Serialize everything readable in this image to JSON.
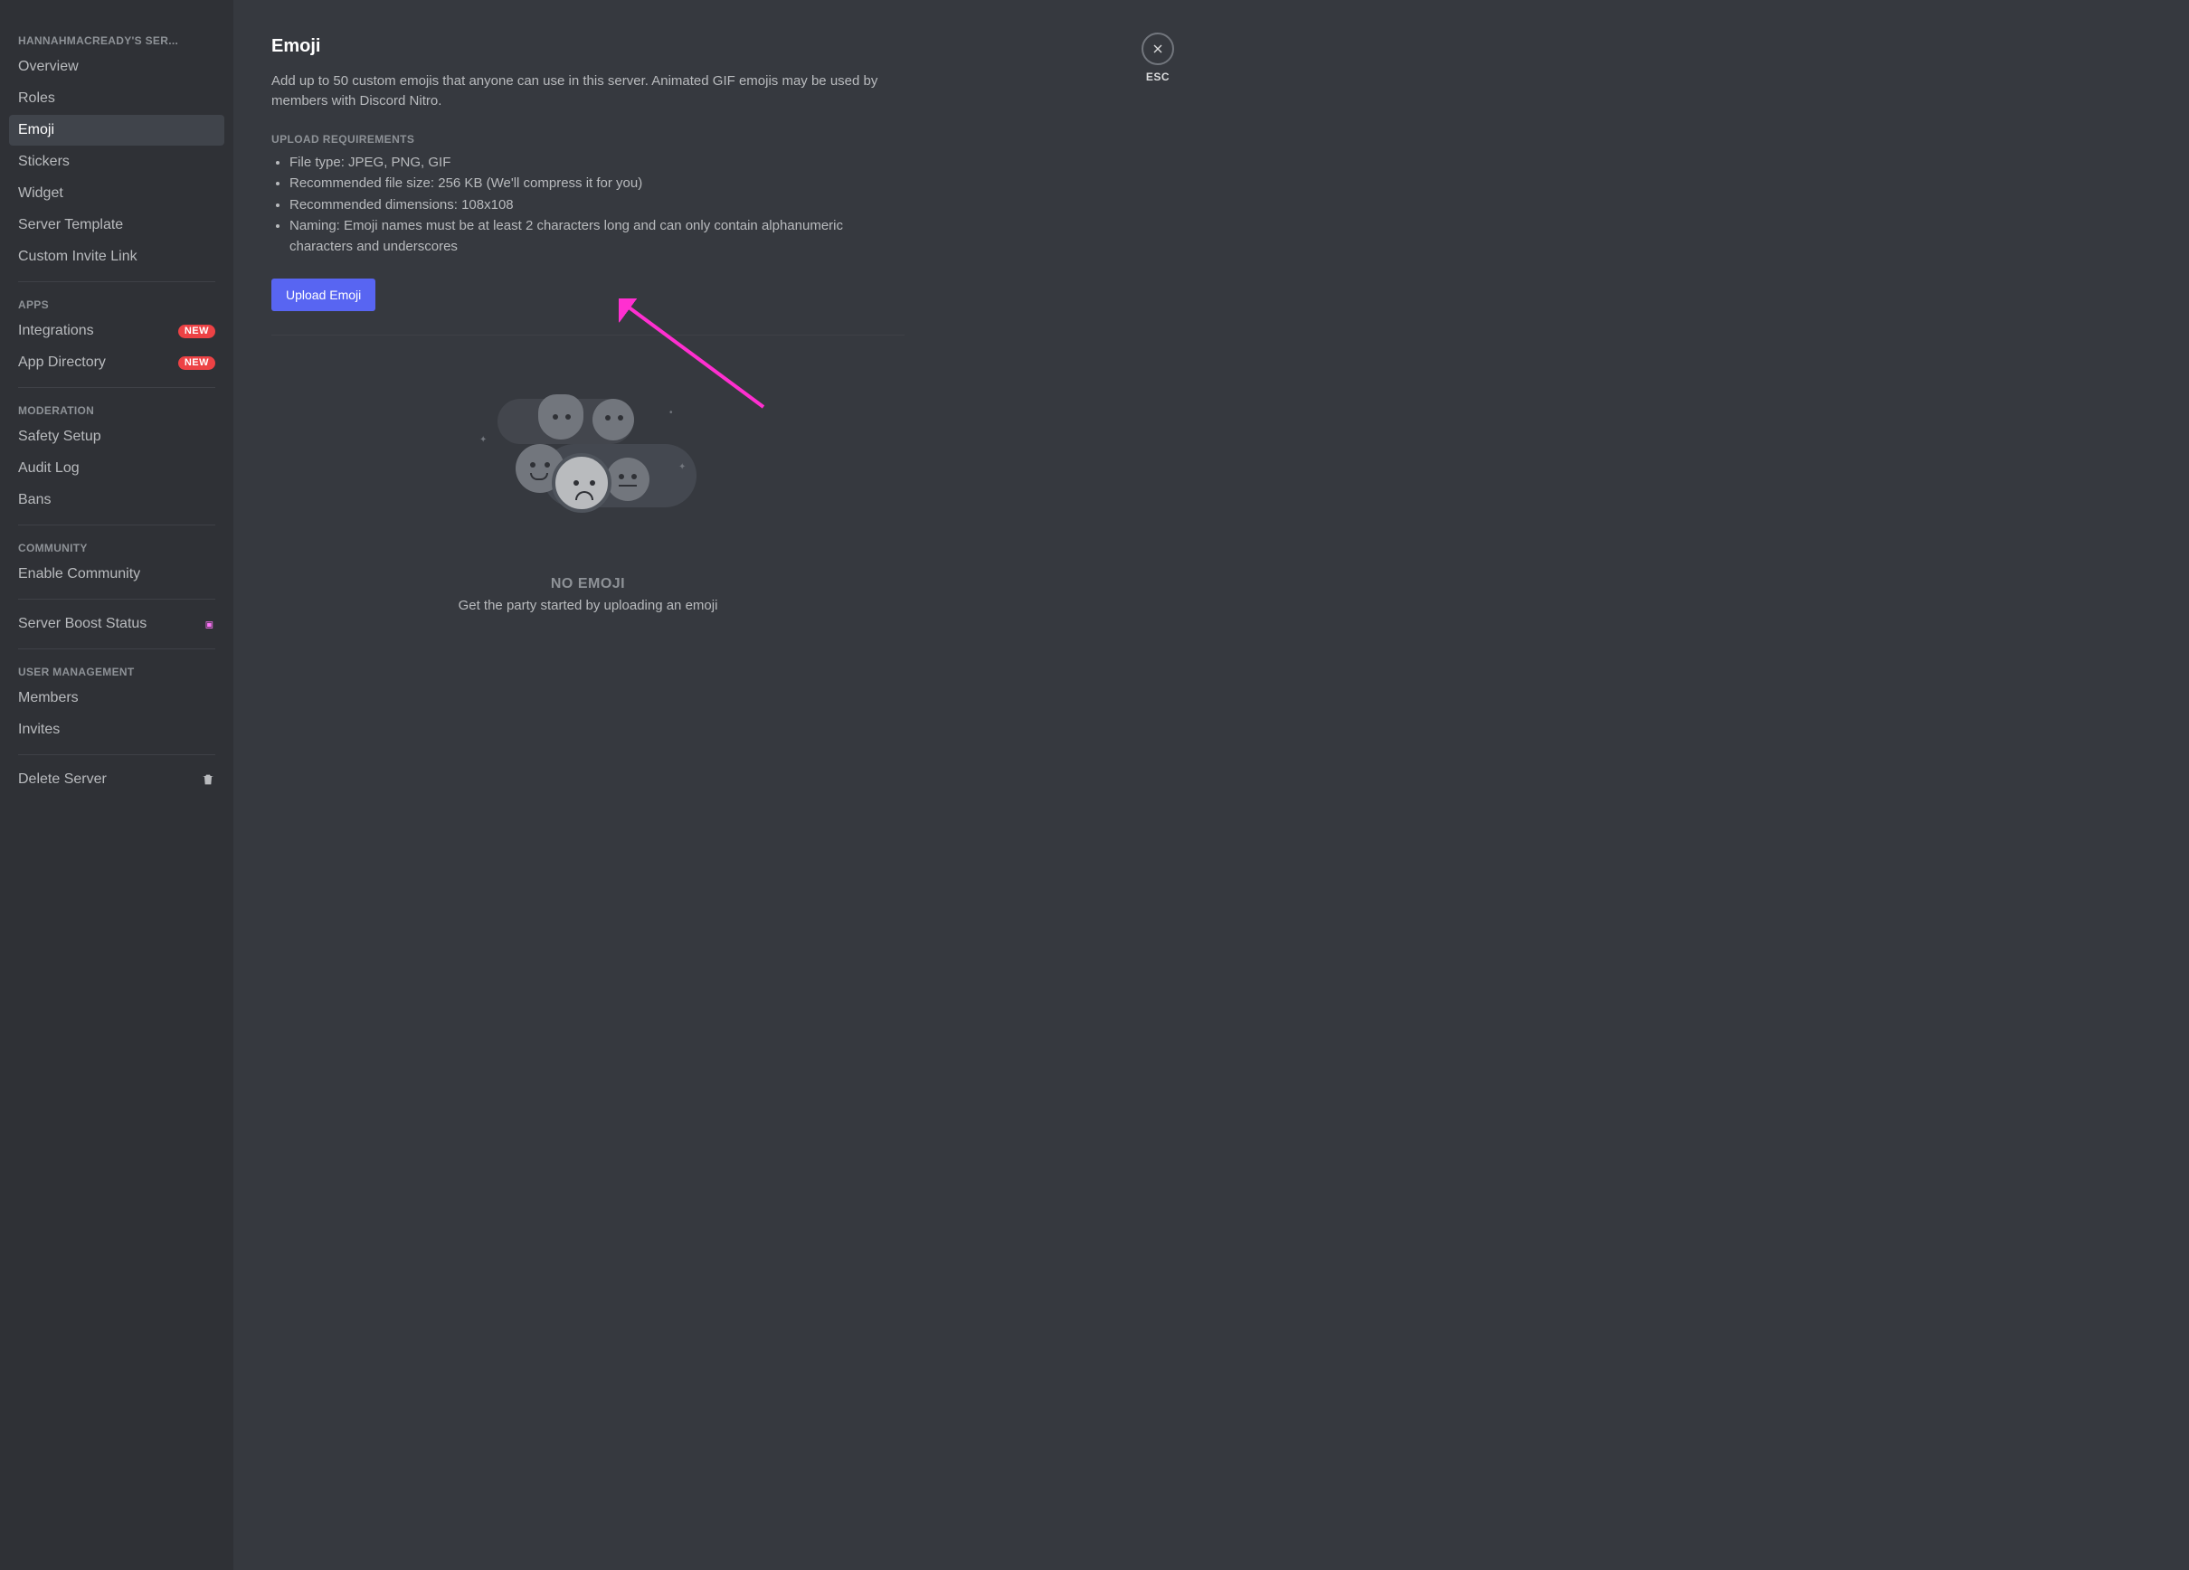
{
  "sidebar": {
    "server_header": "HANNAHMACREADY'S SER...",
    "groups": [
      {
        "items": [
          {
            "key": "overview",
            "label": "Overview"
          },
          {
            "key": "roles",
            "label": "Roles"
          },
          {
            "key": "emoji",
            "label": "Emoji",
            "selected": true
          },
          {
            "key": "stickers",
            "label": "Stickers"
          },
          {
            "key": "widget",
            "label": "Widget"
          },
          {
            "key": "server-template",
            "label": "Server Template"
          },
          {
            "key": "custom-invite-link",
            "label": "Custom Invite Link"
          }
        ]
      },
      {
        "header": "APPS",
        "items": [
          {
            "key": "integrations",
            "label": "Integrations",
            "badge": "NEW"
          },
          {
            "key": "app-directory",
            "label": "App Directory",
            "badge": "NEW"
          }
        ]
      },
      {
        "header": "MODERATION",
        "items": [
          {
            "key": "safety-setup",
            "label": "Safety Setup"
          },
          {
            "key": "audit-log",
            "label": "Audit Log"
          },
          {
            "key": "bans",
            "label": "Bans"
          }
        ]
      },
      {
        "header": "COMMUNITY",
        "items": [
          {
            "key": "enable-community",
            "label": "Enable Community"
          }
        ]
      },
      {
        "items": [
          {
            "key": "server-boost",
            "label": "Server Boost Status",
            "boost": true
          }
        ]
      },
      {
        "header": "USER MANAGEMENT",
        "items": [
          {
            "key": "members",
            "label": "Members"
          },
          {
            "key": "invites",
            "label": "Invites"
          }
        ]
      },
      {
        "items": [
          {
            "key": "delete-server",
            "label": "Delete Server",
            "trash": true
          }
        ]
      }
    ]
  },
  "content": {
    "title": "Emoji",
    "description": "Add up to 50 custom emojis that anyone can use in this server. Animated GIF emojis may be used by members with Discord Nitro.",
    "requirements_header": "UPLOAD REQUIREMENTS",
    "requirements": [
      "File type: JPEG, PNG, GIF",
      "Recommended file size: 256 KB (We'll compress it for you)",
      "Recommended dimensions: 108x108",
      "Naming: Emoji names must be at least 2 characters long and can only contain alphanumeric characters and underscores"
    ],
    "upload_button": "Upload Emoji",
    "empty_title": "NO EMOJI",
    "empty_subtitle": "Get the party started by uploading an emoji"
  },
  "close": {
    "label": "ESC"
  },
  "annotation": {
    "arrow_color": "#ff2fd0"
  }
}
